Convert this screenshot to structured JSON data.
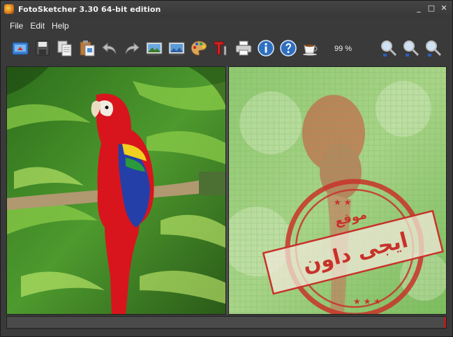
{
  "window": {
    "title": "FotoSketcher 3.30 64-bit edition",
    "controls": {
      "minimize": "_",
      "maximize": "□",
      "close": "✕"
    }
  },
  "menu": [
    "File",
    "Edit",
    "Help"
  ],
  "toolbar": {
    "buttons": [
      "open-icon",
      "save-icon",
      "copy-icon",
      "paste-icon",
      "undo-icon",
      "redo-icon",
      "original-image-icon",
      "result-image-icon",
      "paint-palette-icon",
      "text-icon",
      "print-icon",
      "info-icon",
      "help-icon",
      "coffee-icon"
    ],
    "zoom_level": "99 %",
    "zoom_buttons": [
      "zoom-in-icon",
      "zoom-out-icon",
      "zoom-fit-icon"
    ]
  },
  "watermark": {
    "line1": "موقع",
    "line2": "ايجى داون"
  },
  "colors": {
    "window_bg": "#3a3a3a",
    "accent_blue": "#2f6fc0",
    "stamp_red": "#c8322a",
    "parrot_red": "#d8151c",
    "foliage_green": "#4e9a2e"
  }
}
